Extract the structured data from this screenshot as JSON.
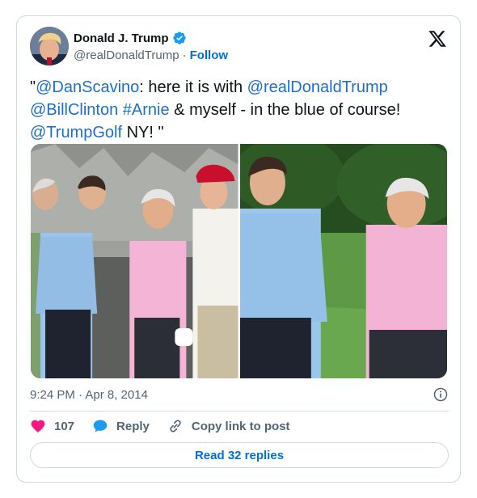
{
  "author": {
    "display_name": "Donald J. Trump",
    "handle": "@realDonaldTrump",
    "separator": "·",
    "follow_label": "Follow",
    "verified": true
  },
  "tweet": {
    "segments": [
      {
        "text": "\"",
        "type": "plain"
      },
      {
        "text": "@DanScavino",
        "type": "link"
      },
      {
        "text": ": here it is with ",
        "type": "plain"
      },
      {
        "text": "@realDonaldTrump",
        "type": "link"
      },
      {
        "text": " ",
        "type": "plain"
      },
      {
        "text": "@BillClinton",
        "type": "link"
      },
      {
        "text": " ",
        "type": "plain"
      },
      {
        "text": "#Arnie",
        "type": "link"
      },
      {
        "text": " & myself - in the blue of course! ",
        "type": "plain"
      },
      {
        "text": "@TrumpGolf",
        "type": "link"
      },
      {
        "text": " NY! \"",
        "type": "plain"
      }
    ]
  },
  "media": [
    {
      "name": "group-golf-photo"
    },
    {
      "name": "golf-course-photo"
    }
  ],
  "meta": {
    "timestamp": "9:24 PM · Apr 8, 2014"
  },
  "actions": {
    "likes_count": "107",
    "reply_label": "Reply",
    "copy_link_label": "Copy link to post"
  },
  "read_replies_label": "Read 32 replies",
  "colors": {
    "link": "#1d6fc9",
    "accent": "#1d9bf0",
    "like": "#f91880",
    "muted": "#536471"
  }
}
